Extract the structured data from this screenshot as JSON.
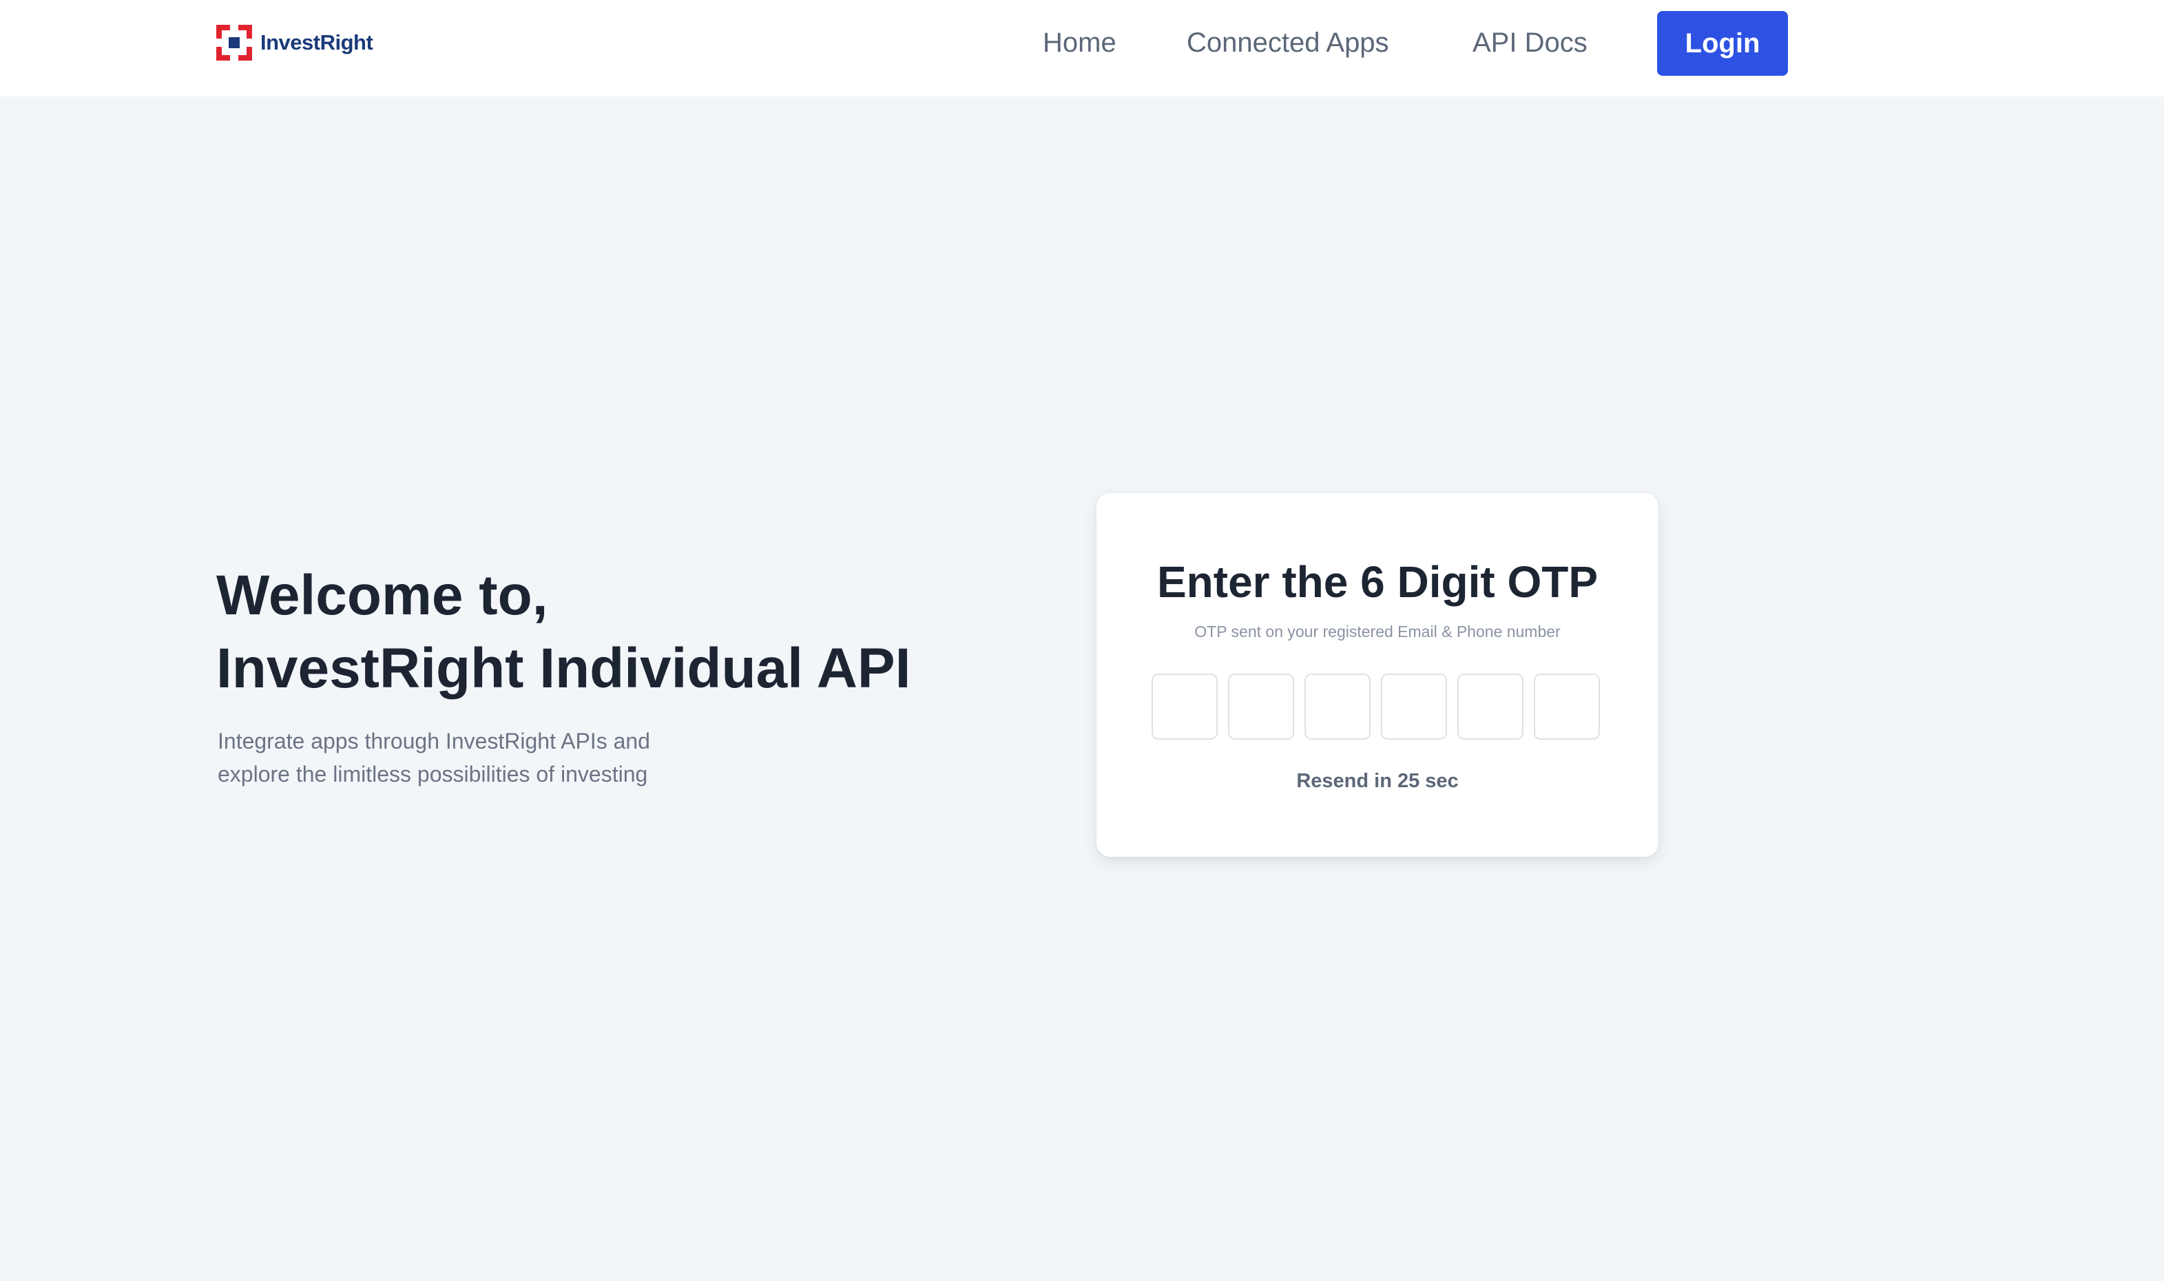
{
  "header": {
    "logo_text": "InvestRight",
    "brand_colors": {
      "red": "#e0242f",
      "navy": "#1a3a7a"
    },
    "nav": {
      "home": "Home",
      "connected_apps": "Connected Apps",
      "api_docs": "API Docs"
    },
    "login_label": "Login",
    "login_color": "#2d52e3"
  },
  "hero": {
    "title_line1": "Welcome to,",
    "title_line2": "InvestRight Individual API",
    "subtitle_line1": "Integrate apps through InvestRight APIs and",
    "subtitle_line2": "explore the limitless possibilities of investing"
  },
  "otp": {
    "title": "Enter the 6 Digit OTP",
    "subtitle": "OTP sent on your registered Email & Phone number",
    "digits": [
      "",
      "",
      "",
      "",
      "",
      ""
    ],
    "resend": "Resend in 25 sec"
  }
}
